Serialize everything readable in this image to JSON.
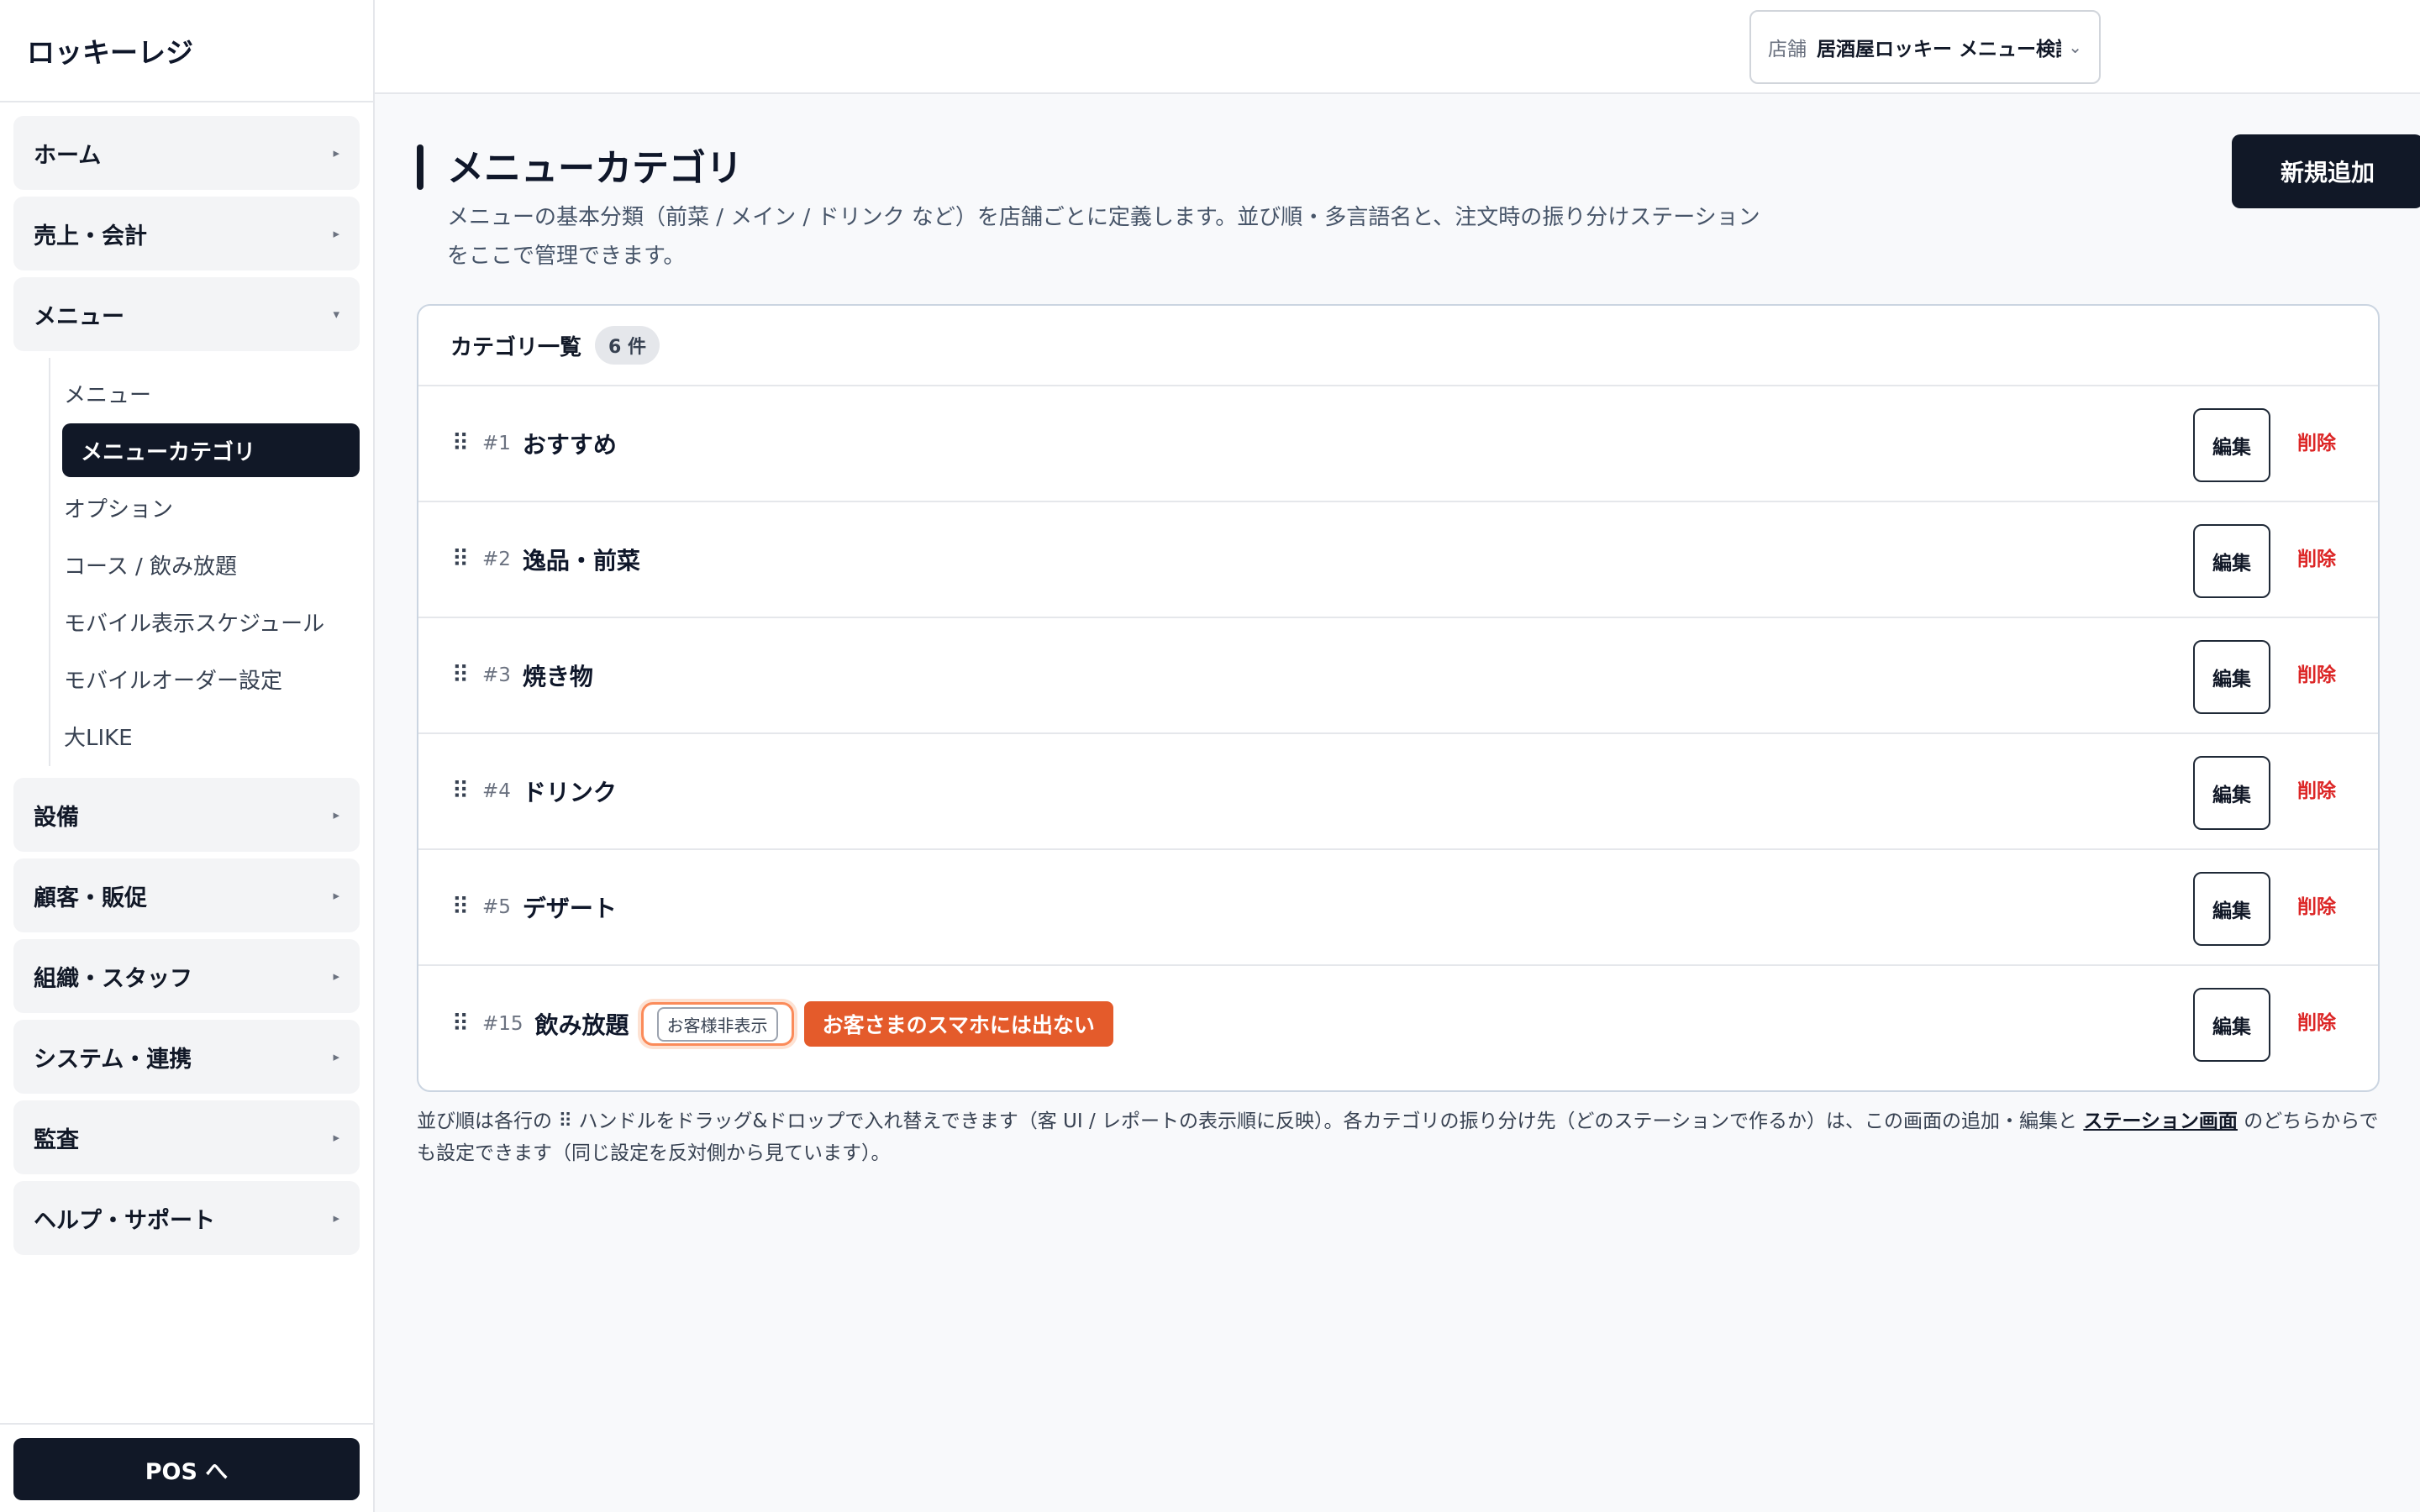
{
  "sidebar": {
    "brand": "ロッキーレジ",
    "groups_top": [
      {
        "label": "ホーム"
      },
      {
        "label": "売上・会計"
      },
      {
        "label": "メニュー"
      }
    ],
    "menu_items": [
      {
        "label": "メニュー"
      },
      {
        "label": "メニューカテゴリ"
      },
      {
        "label": "オプション"
      },
      {
        "label": "コース / 飲み放題"
      },
      {
        "label": "モバイル表示スケジュール"
      },
      {
        "label": "モバイルオーダー設定"
      },
      {
        "label": "大LIKE"
      }
    ],
    "groups_bottom": [
      {
        "label": "設備"
      },
      {
        "label": "顧客・販促"
      },
      {
        "label": "組織・スタッフ"
      },
      {
        "label": "システム・連携"
      },
      {
        "label": "監査"
      },
      {
        "label": "ヘルプ・サポート"
      }
    ],
    "caret_collapsed": "▸",
    "caret_expanded": "▾",
    "pos_button": "POS へ"
  },
  "header": {
    "store_label": "店舗",
    "store_value": "居酒屋ロッキー メニュー検証店",
    "chevron": "⌄"
  },
  "page": {
    "title": "メニューカテゴリ",
    "description": "メニューの基本分類（前菜 / メイン / ドリンク など）を店舗ごとに定義します。並び順・多言語名と、注文時の振り分けステーションをここで管理できます。",
    "add_button": "新規追加"
  },
  "list": {
    "title": "カテゴリ一覧",
    "count": "6 件",
    "edit_label": "編集",
    "delete_label": "削除",
    "handle_glyph": "⠿",
    "rows": [
      {
        "num": "#1",
        "name": "おすすめ"
      },
      {
        "num": "#2",
        "name": "逸品・前菜"
      },
      {
        "num": "#3",
        "name": "焼き物"
      },
      {
        "num": "#4",
        "name": "ドリンク"
      },
      {
        "num": "#5",
        "name": "デザート"
      },
      {
        "num": "#15",
        "name": "飲み放題",
        "hidden_badge": "お客様非表示",
        "note": "お客さまのスマホには出ない"
      }
    ]
  },
  "footer": {
    "text_before": "並び順は各行の ⠿ ハンドルをドラッグ&ドロップで入れ替えできます（客 UI / レポートの表示順に反映）。各カテゴリの振り分け先（どのステーションで作るか）は、この画面の追加・編集と ",
    "link": "ステーション画面",
    "text_after": " のどちらからでも設定できます（同じ設定を反対側から見ています）。"
  },
  "colors": {
    "primary": "#111827",
    "danger": "#dc2626",
    "accent_orange": "#e45b2b"
  }
}
